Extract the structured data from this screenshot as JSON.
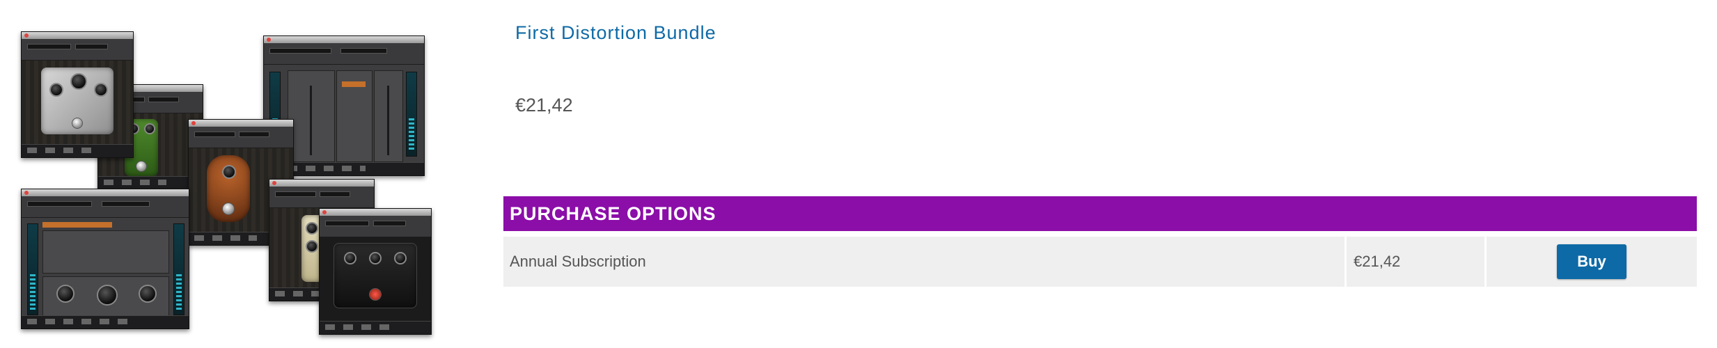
{
  "product": {
    "title": "First Distortion Bundle",
    "price": "€21,42",
    "image_description_icon": "plugin-collage-image"
  },
  "purchase_options": {
    "header": "PURCHASE OPTIONS",
    "rows": [
      {
        "name": "Annual Subscription",
        "price": "€21,42",
        "button_label": "Buy"
      }
    ]
  },
  "colors": {
    "title": "#0e6aa6",
    "header_bg": "#8b0ea8",
    "button_bg": "#0e6aa6",
    "row_bg": "#efefef"
  }
}
